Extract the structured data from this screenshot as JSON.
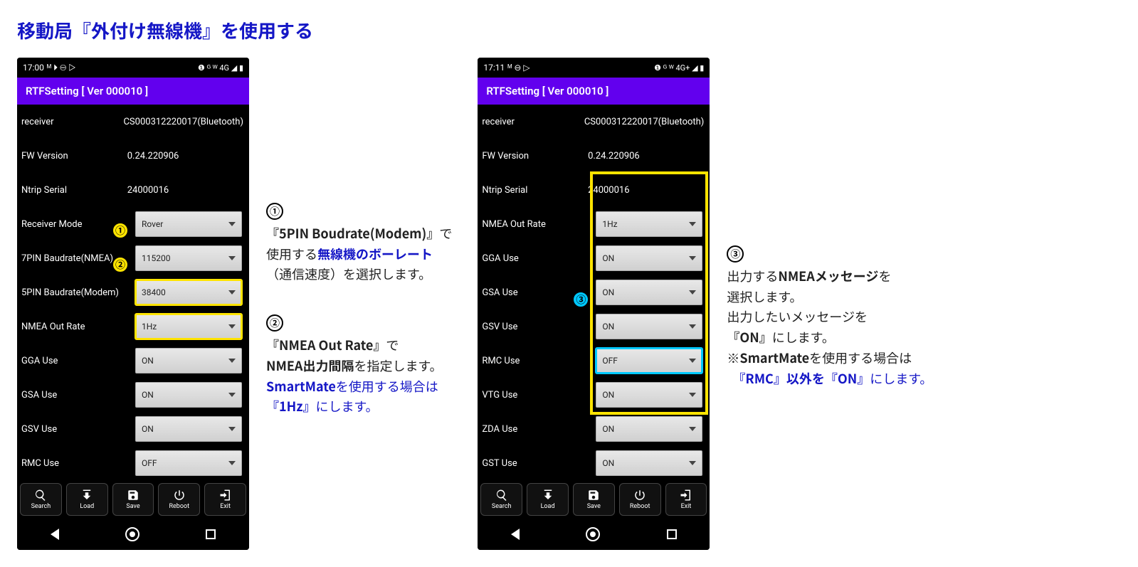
{
  "page_title": "移動局『外付け無線機』を使用する",
  "screens": [
    {
      "status": {
        "time": "17:00",
        "indicators": "ᴹ ⏵ ⊖ ▷",
        "right": "❶ ᴳ ᵂ 4G ◢ ▮"
      },
      "app_title": "RTFSetting  [ Ver 000010 ]",
      "info_rows": [
        {
          "label": "receiver",
          "value": "CS000312220017(Bluetooth)"
        },
        {
          "label": "FW Version",
          "value": "0.24.220906"
        },
        {
          "label": "Ntrip Serial",
          "value": "24000016"
        }
      ],
      "spin_rows": [
        {
          "label": "Receiver Mode",
          "value": "Rover",
          "hl": ""
        },
        {
          "label": "7PIN Baudrate(NMEA)",
          "value": "115200",
          "hl": ""
        },
        {
          "label": "5PIN Baudrate(Modem)",
          "value": "38400",
          "hl": "yellow",
          "marker": "①"
        },
        {
          "label": "NMEA Out Rate",
          "value": "1Hz",
          "hl": "yellow",
          "marker": "②"
        },
        {
          "label": "GGA Use",
          "value": "ON",
          "hl": ""
        },
        {
          "label": "GSA Use",
          "value": "ON",
          "hl": ""
        },
        {
          "label": "GSV Use",
          "value": "ON",
          "hl": ""
        },
        {
          "label": "RMC Use",
          "value": "OFF",
          "hl": ""
        }
      ],
      "buttons": [
        "Search",
        "Load",
        "Save",
        "Reboot",
        "Exit"
      ]
    },
    {
      "status": {
        "time": "17:11",
        "indicators": "ᴹ ⊖ ▷",
        "right": "❶ ᴳ ᵂ 4G+ ◢ ▮"
      },
      "app_title": "RTFSetting  [ Ver 000010 ]",
      "info_rows": [
        {
          "label": "receiver",
          "value": "CS000312220017(Bluetooth)"
        },
        {
          "label": "FW Version",
          "value": "0.24.220906"
        },
        {
          "label": "Ntrip Serial",
          "value": "24000016"
        }
      ],
      "spin_rows": [
        {
          "label": "NMEA Out Rate",
          "value": "1Hz",
          "hl": ""
        },
        {
          "label": "GGA Use",
          "value": "ON",
          "hl": ""
        },
        {
          "label": "GSA Use",
          "value": "ON",
          "hl": ""
        },
        {
          "label": "GSV Use",
          "value": "ON",
          "hl": ""
        },
        {
          "label": "RMC Use",
          "value": "OFF",
          "hl": "cyan",
          "marker": "③"
        },
        {
          "label": "VTG Use",
          "value": "ON",
          "hl": ""
        },
        {
          "label": "ZDA Use",
          "value": "ON",
          "hl": ""
        },
        {
          "label": "GST Use",
          "value": "ON",
          "hl": ""
        }
      ],
      "buttons": [
        "Search",
        "Load",
        "Save",
        "Reboot",
        "Exit"
      ]
    }
  ],
  "annotations": {
    "a1": {
      "num": "①",
      "l1a": "『5PIN Boudrate(Modem)』",
      "l1b": "で",
      "l2a": "使用する",
      "l2b": "無線機のボーレート",
      "l3": "（通信速度）を選択します。"
    },
    "a2": {
      "num": "②",
      "l1a": "『NMEA Out Rate』",
      "l1b": "で",
      "l2a": "NMEA出力間隔",
      "l2b": "を指定します。",
      "l3a": "SmartMate",
      "l3b": "を使用する場合は",
      "l4a": "『1Hz』",
      "l4b": "にします。"
    },
    "a3": {
      "num": "③",
      "l1a": "出力する",
      "l1b": "NMEAメッセージ",
      "l1c": "を",
      "l2": "選択します。",
      "l3": "出力したいメッセージを",
      "l4a": "『ON』",
      "l4b": "にします。",
      "l5a": "※",
      "l5b": "SmartMate",
      "l5c": "を使用する場合は",
      "l6a": "『RMC』以外を『ON』",
      "l6b": "にします。"
    }
  },
  "markers": {
    "m1": "①",
    "m2": "②",
    "m3": "③"
  }
}
